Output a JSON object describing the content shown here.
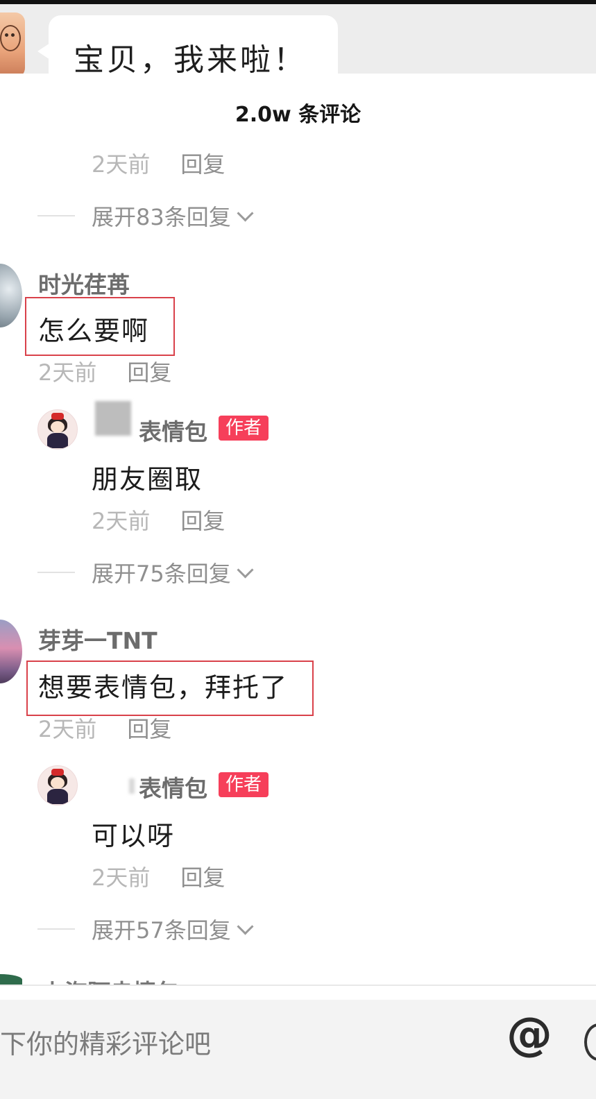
{
  "video": {
    "bubble_text": "宝贝，我来啦！"
  },
  "comments_header": {
    "count_label": "2.0w 条评论"
  },
  "thread0": {
    "time": "2天前",
    "reply": "回复",
    "expand": "展开83条回复"
  },
  "thread1": {
    "username": "时光荏苒",
    "text": "怎么要啊",
    "time": "2天前",
    "reply": "回复",
    "author_reply": {
      "username_suffix": "表情包",
      "badge": "作者",
      "text": "朋友圈取",
      "time": "2天前",
      "reply": "回复"
    },
    "expand": "展开75条回复"
  },
  "thread2": {
    "username": "芽芽一TNT",
    "text": "想要表情包，拜托了",
    "time": "2天前",
    "reply": "回复",
    "author_reply": {
      "username_suffix": "表情包",
      "badge": "作者",
      "text": "可以呀",
      "time": "2天前",
      "reply": "回复"
    },
    "expand": "展开57条回复"
  },
  "thread3": {
    "username_partial": "上海阿赤情包"
  },
  "input": {
    "placeholder": "下你的精彩评论吧"
  },
  "icons": {
    "mention": "at-icon",
    "emoji": "emoji-icon"
  },
  "colors": {
    "author_badge": "#f63f5a",
    "highlight_box": "#d9414a"
  }
}
